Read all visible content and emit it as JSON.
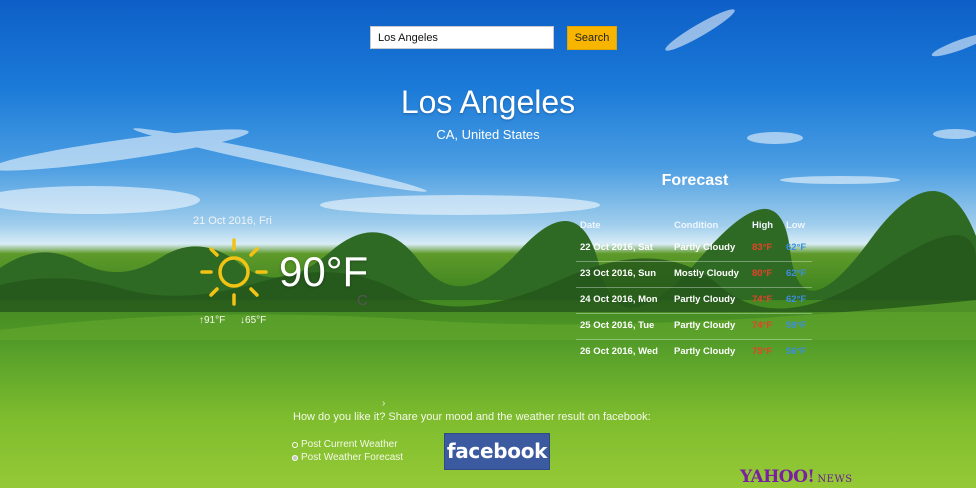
{
  "search": {
    "value": "Los Angeles",
    "button_label": "Search"
  },
  "location": {
    "city": "Los Angeles",
    "region": "CA, United States"
  },
  "current": {
    "date": "21 Oct 2016, Fri",
    "temp": "90°F",
    "unit_toggle": "C",
    "high": "↑91°F",
    "low": "↓65°F",
    "icon": "sun-icon"
  },
  "forecast": {
    "title": "Forecast",
    "headers": {
      "date": "Date",
      "condition": "Condition",
      "high": "High",
      "low": "Low"
    },
    "rows": [
      {
        "date": "22 Oct 2016, Sat",
        "condition": "Partly Cloudy",
        "high": "83°F",
        "low": "62°F"
      },
      {
        "date": "23 Oct 2016, Sun",
        "condition": "Mostly Cloudy",
        "high": "80°F",
        "low": "62°F"
      },
      {
        "date": "24 Oct 2016, Mon",
        "condition": "Partly Cloudy",
        "high": "74°F",
        "low": "62°F"
      },
      {
        "date": "25 Oct 2016, Tue",
        "condition": "Partly Cloudy",
        "high": "74°F",
        "low": "59°F"
      },
      {
        "date": "26 Oct 2016, Wed",
        "condition": "Partly Cloudy",
        "high": "75°F",
        "low": "56°F"
      }
    ]
  },
  "share": {
    "prompt": "How do you like it? Share your mood and the weather result on facebook:",
    "caret": "›",
    "options": [
      {
        "label": "Post Current Weather",
        "selected": false
      },
      {
        "label": "Post Weather Forecast",
        "selected": true
      }
    ],
    "facebook_label": "facebook"
  },
  "branding": {
    "yahoo": "YAHOO!",
    "news": "NEWS"
  },
  "colors": {
    "high_temp": "#e8402a",
    "low_temp": "#3b8ee0",
    "search_button": "#f7b500",
    "facebook": "#3b5aa0",
    "yahoo": "#7b1fa2"
  }
}
